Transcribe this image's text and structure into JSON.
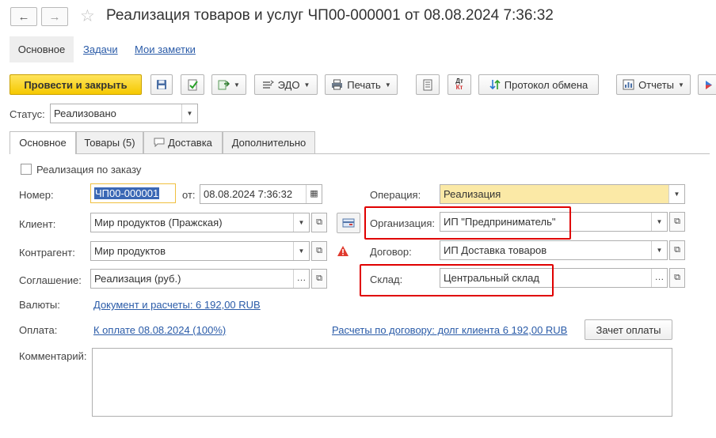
{
  "window": {
    "title": "Реализация товаров и услуг ЧП00-000001 от 08.08.2024 7:36:32"
  },
  "nav_tabs": {
    "main": "Основное",
    "tasks": "Задачи",
    "notes": "Мои заметки"
  },
  "toolbar": {
    "post_close": "Провести и закрыть",
    "edo": "ЭДО",
    "print": "Печать",
    "exchange_log": "Протокол обмена",
    "reports": "Отчеты"
  },
  "status": {
    "label": "Статус:",
    "value": "Реализовано"
  },
  "doc_tabs": {
    "main": "Основное",
    "goods": "Товары (5)",
    "delivery": "Доставка",
    "extra": "Дополнительно"
  },
  "form": {
    "by_order_label": "Реализация по заказу",
    "number_label": "Номер:",
    "number_value": "ЧП00-000001",
    "from_label": "от:",
    "date_value": "08.08.2024  7:36:32",
    "client_label": "Клиент:",
    "client_value": "Мир продуктов (Пражская)",
    "contractor_label": "Контрагент:",
    "contractor_value": "Мир продуктов",
    "agreement_label": "Соглашение:",
    "agreement_value": "Реализация (руб.)",
    "currency_label": "Валюты:",
    "currency_link": "Документ и расчеты: 6 192,00 RUB",
    "payment_label": "Оплата:",
    "payment_link": "К оплате 08.08.2024 (100%)",
    "settlement_link": "Расчеты по договору: долг клиента 6 192,00 RUB",
    "offset_button": "Зачет оплаты",
    "comment_label": "Комментарий:",
    "operation_label": "Операция:",
    "operation_value": "Реализация",
    "org_label": "Организация:",
    "org_value": "ИП \"Предприниматель\"",
    "contract_label": "Договор:",
    "contract_value": "ИП Доставка товаров",
    "warehouse_label": "Склад:",
    "warehouse_value": "Центральный склад"
  },
  "colors": {
    "primary_button": "#f5c800",
    "highlight_field": "#fbe9a6",
    "link": "#2a5ba8",
    "annotation": "#e00000"
  }
}
